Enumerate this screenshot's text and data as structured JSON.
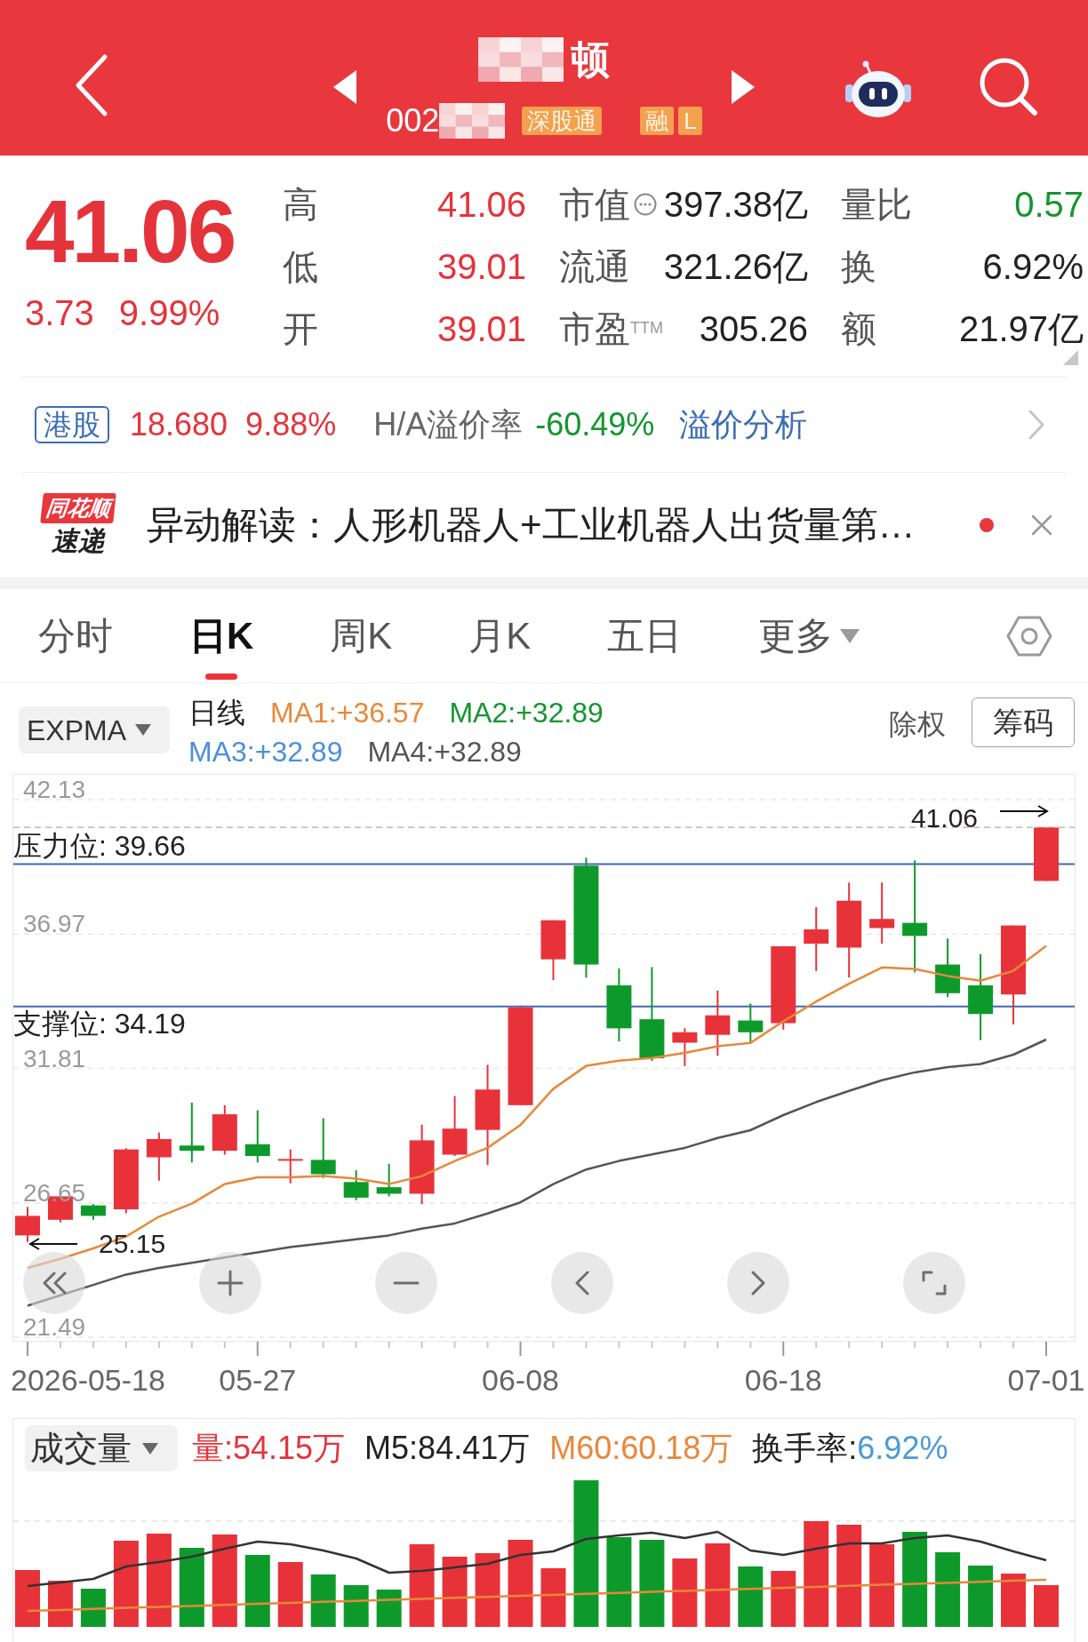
{
  "header": {
    "title": "顿",
    "title_masked": true,
    "code": "002",
    "code_masked": true,
    "badges": [
      {
        "label": "深股通"
      },
      {
        "label": "融"
      },
      {
        "label": "L"
      }
    ]
  },
  "quote": {
    "price": "41.06",
    "change": "3.73",
    "change_percent": "9.99%",
    "rising": true,
    "rows": [
      [
        {
          "label": "高",
          "value": "41.06",
          "color": "#e4343b"
        },
        {
          "label": "市值",
          "value": "397.38亿",
          "color": "#222222",
          "info_button": true
        },
        {
          "label": "量比",
          "value": "0.57",
          "color": "#13962f"
        }
      ],
      [
        {
          "label": "低",
          "value": "39.01",
          "color": "#e4343b"
        },
        {
          "label": "流通",
          "value": "321.26亿",
          "color": "#222222"
        },
        {
          "label": "换",
          "value": "6.92%",
          "color": "#222222"
        }
      ],
      [
        {
          "label": "开",
          "value": "39.01",
          "color": "#e4343b"
        },
        {
          "label": "市盈$^{TTM}$",
          "value": "305.26",
          "color": "#222222"
        },
        {
          "label": "额",
          "value": "21.97亿",
          "color": "#222222"
        }
      ]
    ]
  },
  "hk_quote": {
    "tag": "港股",
    "price": "18.680",
    "change_percent": "9.88%",
    "rising": true,
    "premium_label": "H/A溢价率",
    "premium_value": "-60.49%",
    "premium_rising": false,
    "link": "溢价分析"
  },
  "news": {
    "source_badge": "同花顺",
    "source_label": "速递",
    "headline": "异动解读：人形机器人+工业机器人出货量第…",
    "unread": true
  },
  "period_tabs": [
    {
      "label": "分时",
      "selected": false,
      "kind": "tab"
    },
    {
      "label": "日K",
      "selected": true,
      "kind": "tab"
    },
    {
      "label": "周K",
      "selected": false,
      "kind": "tab"
    },
    {
      "label": "月K",
      "selected": false,
      "kind": "tab"
    },
    {
      "label": "五日",
      "selected": false,
      "kind": "tab"
    },
    {
      "label": "更多",
      "selected": false,
      "kind": "dropdown"
    }
  ],
  "indicator_bar": {
    "indicator": "EXPMA",
    "period": "日线",
    "ma": [
      {
        "label": "MA1:+36.57",
        "color": "#e8883a"
      },
      {
        "label": "MA2:+32.89",
        "color": "#13962f"
      },
      {
        "label": "MA3:+32.89",
        "color": "#4a90d9"
      },
      {
        "label": "MA4:+32.89",
        "color": "#555555"
      }
    ],
    "adjust": "除权",
    "chips_button": "筹码"
  },
  "chart": {
    "chart_data": {
      "type": "line",
      "categories": [
        null,
        null,
        null,
        null,
        null,
        null,
        null,
        "05-27",
        null,
        null,
        null,
        null,
        null,
        null,
        null,
        "06-08",
        null,
        null,
        null,
        null,
        null,
        null,
        null,
        "06-18",
        null,
        null,
        null,
        null,
        null,
        null,
        null,
        "07-01"
      ],
      "ylim": [
        21.49,
        42.13
      ],
      "yticks": [
        42.13,
        36.97,
        31.81,
        26.65,
        21.49
      ],
      "grid": true,
      "series": [
        {
          "color": "#e8883a",
          "values": [
            24.15,
            24.5,
            24.9,
            25.36,
            26.12,
            26.62,
            27.37,
            27.63,
            27.63,
            27.68,
            27.58,
            27.37,
            27.68,
            28.26,
            28.76,
            29.64,
            31.03,
            31.91,
            32.11,
            32.21,
            32.41,
            32.66,
            32.79,
            33.62,
            34.38,
            35.06,
            35.69,
            35.63,
            35.36,
            35.18,
            35.56,
            36.52
          ]
        },
        {
          "color": "#555555",
          "values": [
            22.7,
            23.1,
            23.5,
            23.9,
            24.15,
            24.35,
            24.55,
            24.75,
            24.95,
            25.1,
            25.25,
            25.4,
            25.66,
            25.86,
            26.24,
            26.67,
            27.37,
            27.93,
            28.26,
            28.51,
            28.76,
            29.14,
            29.44,
            30.02,
            30.52,
            30.95,
            31.36,
            31.66,
            31.86,
            31.98,
            32.34,
            32.92
          ]
        }
      ],
      "ref_lines": [
        {
          "axis": "y",
          "value": 41.06
        },
        {
          "axis": "y",
          "value": 39.66,
          "label": "压力位: 39.66"
        },
        {
          "axis": "y",
          "value": 34.19,
          "label": "支撑位: 34.19"
        }
      ],
      "annotations": [
        "41.06",
        "25.15",
        "2026-05-18"
      ]
    }
  },
  "volume": {
    "indicator": "成交量",
    "readouts": [
      {
        "label": "量:54.15万",
        "color": "#e4343b"
      },
      {
        "label": "M5:84.41万",
        "color": "#222222"
      },
      {
        "label": "M60:60.18万",
        "color": "#e8883a"
      }
    ],
    "turnover_label": "换手率:",
    "turnover_value": "6.92%"
  }
}
